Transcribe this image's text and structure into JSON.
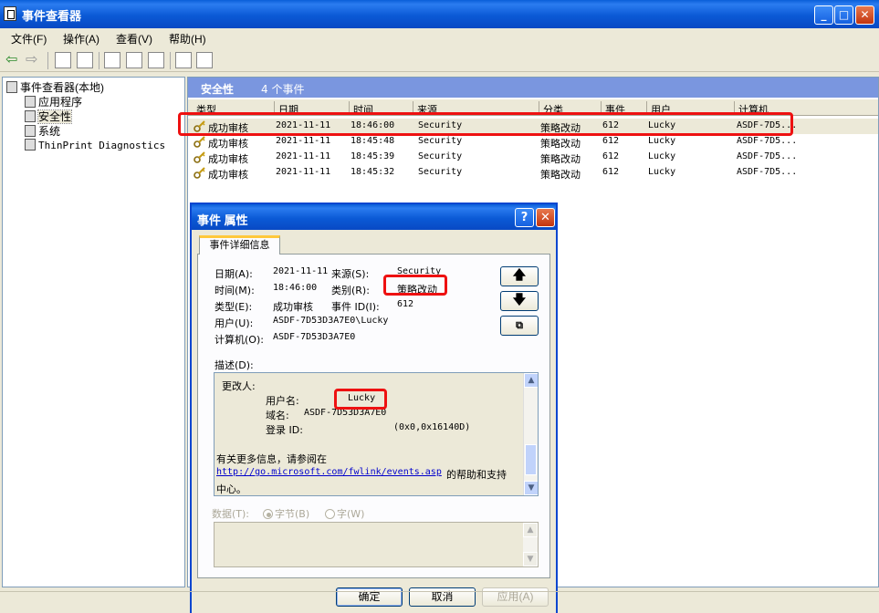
{
  "window": {
    "title": "事件查看器"
  },
  "menu": [
    "文件(F)",
    "操作(A)",
    "查看(V)",
    "帮助(H)"
  ],
  "tree": {
    "root": "事件查看器(本地)",
    "items": [
      "应用程序",
      "安全性",
      "系统",
      "ThinPrint Diagnostics"
    ]
  },
  "list": {
    "header_title": "安全性",
    "header_count": "4 个事件",
    "columns": [
      "类型",
      "日期",
      "时间",
      "来源",
      "分类",
      "事件",
      "用户",
      "计算机"
    ],
    "rows": [
      [
        "成功审核",
        "2021-11-11",
        "18:46:00",
        "Security",
        "策略改动",
        "612",
        "Lucky",
        "ASDF-7D5..."
      ],
      [
        "成功审核",
        "2021-11-11",
        "18:45:48",
        "Security",
        "策略改动",
        "612",
        "Lucky",
        "ASDF-7D5..."
      ],
      [
        "成功审核",
        "2021-11-11",
        "18:45:39",
        "Security",
        "策略改动",
        "612",
        "Lucky",
        "ASDF-7D5..."
      ],
      [
        "成功审核",
        "2021-11-11",
        "18:45:32",
        "Security",
        "策略改动",
        "612",
        "Lucky",
        "ASDF-7D5..."
      ]
    ]
  },
  "dialog": {
    "title": "事件 属性",
    "tab": "事件详细信息",
    "date_label": "日期(A):",
    "date": "2021-11-11",
    "source_label": "来源(S):",
    "source": "Security",
    "time_label": "时间(M):",
    "time": "18:46:00",
    "category_label": "类别(R):",
    "category": "策略改动",
    "type_label": "类型(E):",
    "type": "成功审核",
    "eventid_label": "事件 ID(I):",
    "eventid": "612",
    "user_label": "用户(U):",
    "user": "ASDF-7D53D3A7E0\\Lucky",
    "computer_label": "计算机(O):",
    "computer": "ASDF-7D53D3A7E0",
    "desc_label": "描述(D):",
    "desc": {
      "line1": "更改人:",
      "username_label": "用户名:",
      "username": "Lucky",
      "domain_label": "域名:",
      "domain": "ASDF-7D53D3A7E0",
      "logon_label": "登录 ID:",
      "logon": "(0x0,0x16140D)",
      "more_info": "有关更多信息，请参阅在",
      "link": "http://go.microsoft.com/fwlink/events.asp",
      "after_link": "的帮助和支持",
      "center": "中心。"
    },
    "data_label": "数据(T):",
    "radio_bytes": "字节(B)",
    "radio_words": "字(W)",
    "ok": "确定",
    "cancel": "取消",
    "apply": "应用(A)"
  }
}
